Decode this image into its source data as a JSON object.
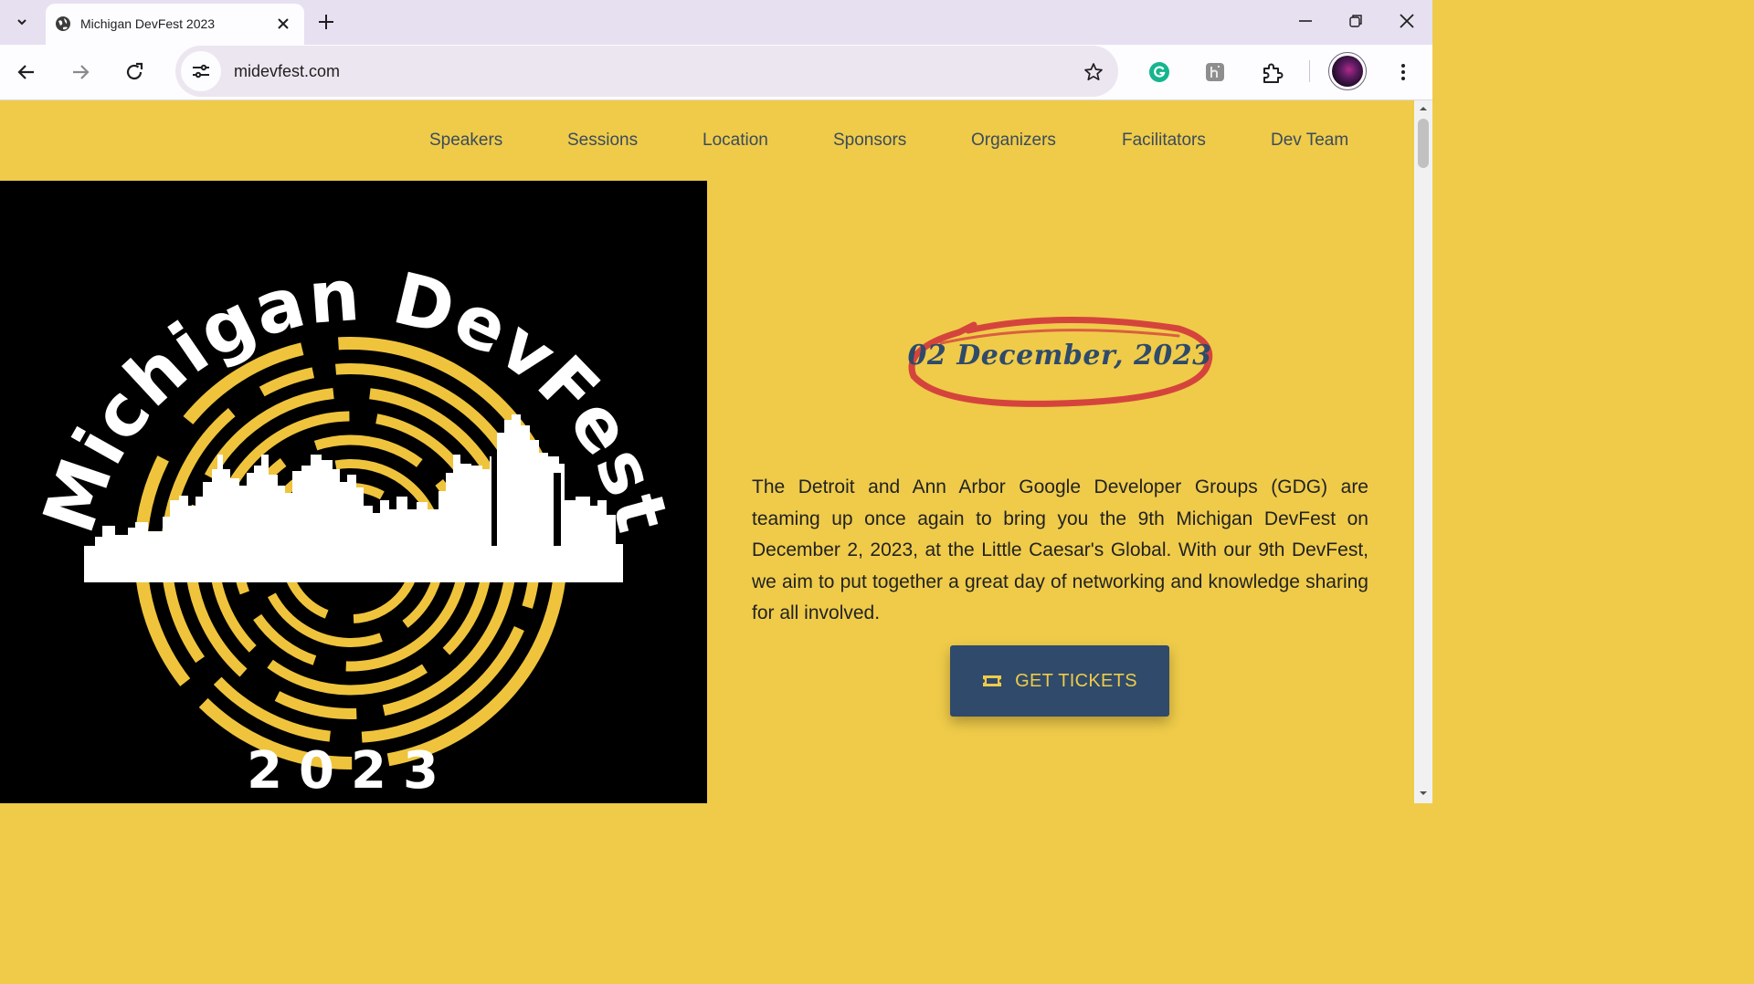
{
  "browser": {
    "tab_title": "Michigan DevFest 2023",
    "url": "midevfest.com",
    "icons": {
      "tab_search": "chevron-down-icon",
      "favicon": "globe-icon",
      "tab_close": "close-icon",
      "new_tab": "plus-icon",
      "minimize": "minimize-icon",
      "restore": "restore-icon",
      "close_window": "close-icon",
      "back": "arrow-left-icon",
      "forward": "arrow-right-icon",
      "reload": "reload-icon",
      "site_info": "tune-icon",
      "bookmark": "star-icon",
      "grammarly": "grammarly-icon",
      "extension_h": "extension-icon",
      "extensions": "puzzle-icon",
      "menu": "kebab-menu-icon"
    }
  },
  "nav": {
    "items": [
      {
        "label": "Speakers"
      },
      {
        "label": "Sessions"
      },
      {
        "label": "Location"
      },
      {
        "label": "Sponsors"
      },
      {
        "label": "Organizers"
      },
      {
        "label": "Facilitators"
      },
      {
        "label": "Dev Team"
      }
    ]
  },
  "logo": {
    "title": "Michigan DevFest",
    "year": "2023"
  },
  "hero": {
    "date": "02 December, 2023",
    "description": "The Detroit and Ann Arbor Google Developer Groups (GDG) are teaming up once again to bring you the 9th Michigan DevFest on December 2, 2023, at the Little Caesar's Global. With our 9th DevFest, we aim to put together a great day of networking and knowledge sharing for all involved.",
    "cta_label": "GET TICKETS",
    "cta_icon": "ticket-icon"
  },
  "colors": {
    "page_bg": "#efcb49",
    "accent_navy": "#2f4a6a",
    "logo_bg": "#000000",
    "circle_stroke": "#red"
  }
}
